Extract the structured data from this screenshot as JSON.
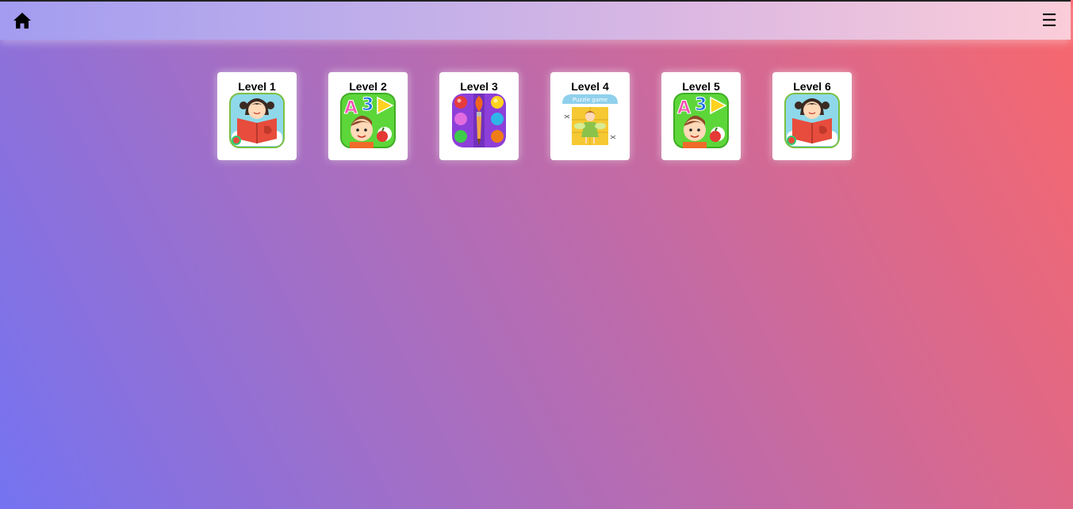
{
  "header": {
    "home_icon": "home-icon",
    "menu_icon": "hamburger-menu-icon",
    "menu_glyph": "☰"
  },
  "levels": [
    {
      "label": "Level 1",
      "art": "girl-reading-book"
    },
    {
      "label": "Level 2",
      "art": "boy-abc-learning"
    },
    {
      "label": "Level 3",
      "art": "color-paint-palette"
    },
    {
      "label": "Level 4",
      "art": "puzzle-game-fairy",
      "art_text": "Puzzle game"
    },
    {
      "label": "Level 5",
      "art": "boy-abc-learning"
    },
    {
      "label": "Level 6",
      "art": "girl-reading-book"
    }
  ],
  "colors": {
    "background_start": "#7573f1",
    "background_end": "#f8676c",
    "header_start": "#a39cf0",
    "header_end": "#fbcdd9",
    "card": "#ffffff"
  }
}
